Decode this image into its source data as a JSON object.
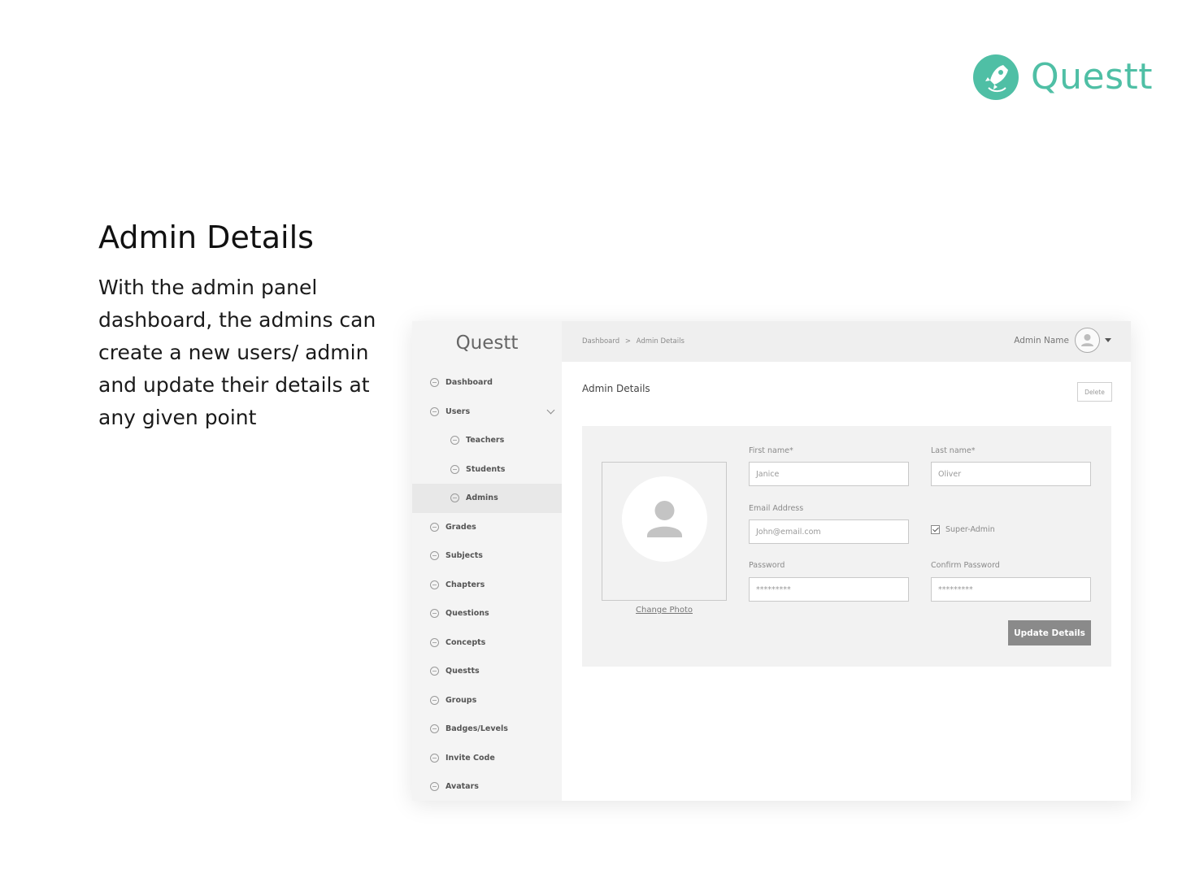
{
  "brand": {
    "name": "Questt",
    "accent": "#4fbfa5"
  },
  "intro": {
    "title": "Admin Details",
    "description": "With the admin panel dashboard, the admins can create a new users/ admin and update their details at any given point"
  },
  "app": {
    "logo": "Questt",
    "sidebar": {
      "items": [
        {
          "label": "Dashboard",
          "icon": "circle-icon"
        },
        {
          "label": "Users",
          "icon": "circle-icon",
          "expanded": true
        },
        {
          "label": "Teachers",
          "icon": "circle-icon",
          "sub": true
        },
        {
          "label": "Students",
          "icon": "circle-icon",
          "sub": true
        },
        {
          "label": "Admins",
          "icon": "circle-icon",
          "sub": true,
          "active": true
        },
        {
          "label": "Grades",
          "icon": "circle-icon"
        },
        {
          "label": "Subjects",
          "icon": "circle-icon"
        },
        {
          "label": "Chapters",
          "icon": "circle-icon"
        },
        {
          "label": "Questions",
          "icon": "circle-icon"
        },
        {
          "label": "Concepts",
          "icon": "circle-icon"
        },
        {
          "label": "Questts",
          "icon": "circle-icon"
        },
        {
          "label": "Groups",
          "icon": "circle-icon"
        },
        {
          "label": "Badges/Levels",
          "icon": "circle-icon"
        },
        {
          "label": "Invite Code",
          "icon": "circle-icon"
        },
        {
          "label": "Avatars",
          "icon": "circle-icon"
        }
      ]
    },
    "topbar": {
      "breadcrumb": [
        "Dashboard",
        ">",
        "Admin Details"
      ],
      "user_name": "Admin Name"
    },
    "page": {
      "title": "Admin Details",
      "delete_label": "Delete",
      "change_photo": "Change Photo",
      "form": {
        "first_name": {
          "label": "First name*",
          "value": "Janice"
        },
        "last_name": {
          "label": "Last name*",
          "value": "Oliver"
        },
        "email": {
          "label": "Email Address",
          "value": "John@email.com"
        },
        "super_admin": {
          "label": "Super-Admin",
          "checked": true
        },
        "password": {
          "label": "Password",
          "value": "*********"
        },
        "confirm_password": {
          "label": "Confirm Password",
          "value": "*********"
        }
      },
      "update_label": "Update Details"
    }
  }
}
